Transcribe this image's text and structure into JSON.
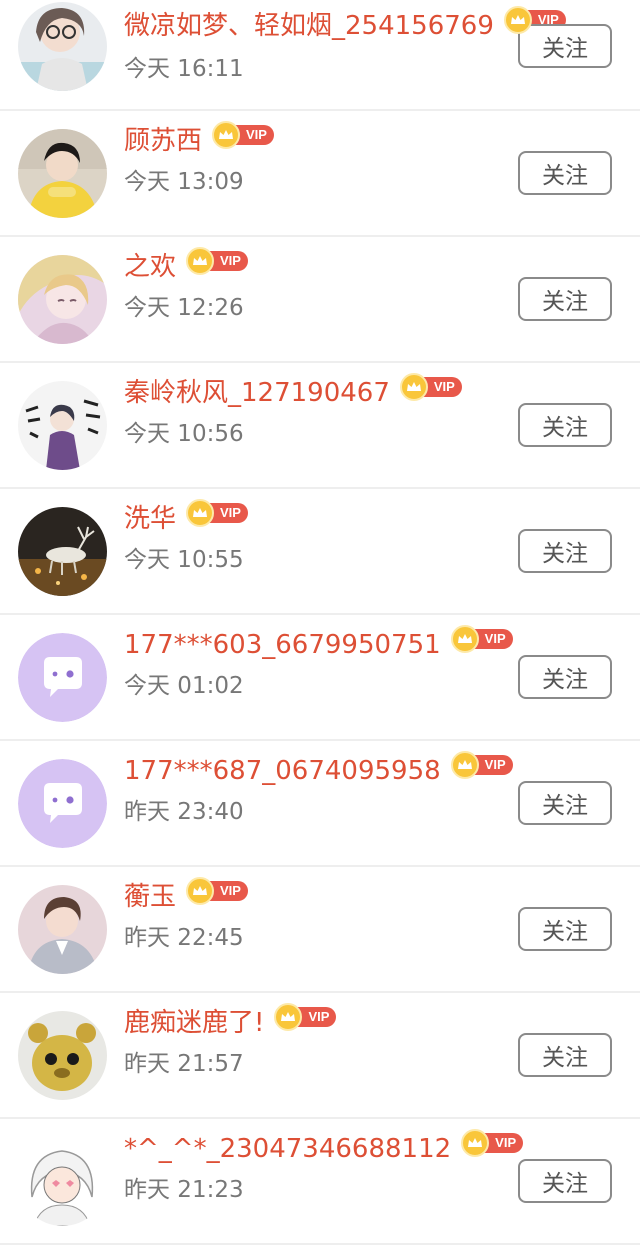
{
  "follow_label": "关注",
  "vip_label": "VIP",
  "colors": {
    "name": "#dd4f35",
    "time": "#777777",
    "vip_pill": "#e8584a",
    "crown": "#f9c63a",
    "button_border": "#8a8a8a",
    "divider": "#eeeeee"
  },
  "users": [
    {
      "name": "微凉如梦、轻如烟_254156769",
      "time": "今天 16:11",
      "avatar": "photo-girl-glasses"
    },
    {
      "name": "顾苏西",
      "time": "今天 13:09",
      "avatar": "photo-boy-yellow"
    },
    {
      "name": "之欢",
      "time": "今天 12:26",
      "avatar": "illustration-girl"
    },
    {
      "name": "秦岭秋风_127190467",
      "time": "今天 10:56",
      "avatar": "anime-calligraphy"
    },
    {
      "name": "洗华",
      "time": "今天 10:55",
      "avatar": "fantasy-deer"
    },
    {
      "name": "177***603_6679950751",
      "time": "今天 01:02",
      "avatar": "default-chat-icon"
    },
    {
      "name": "177***687_0674095958",
      "time": "昨天 23:40",
      "avatar": "default-chat-icon"
    },
    {
      "name": "蘅玉",
      "time": "昨天 22:45",
      "avatar": "photo-man-suit"
    },
    {
      "name": "鹿痴迷鹿了!",
      "time": "昨天 21:57",
      "avatar": "cartoon-bear"
    },
    {
      "name": "*^_^*_23047346688112",
      "time": "昨天 21:23",
      "avatar": "cartoon-girl-hood"
    }
  ]
}
